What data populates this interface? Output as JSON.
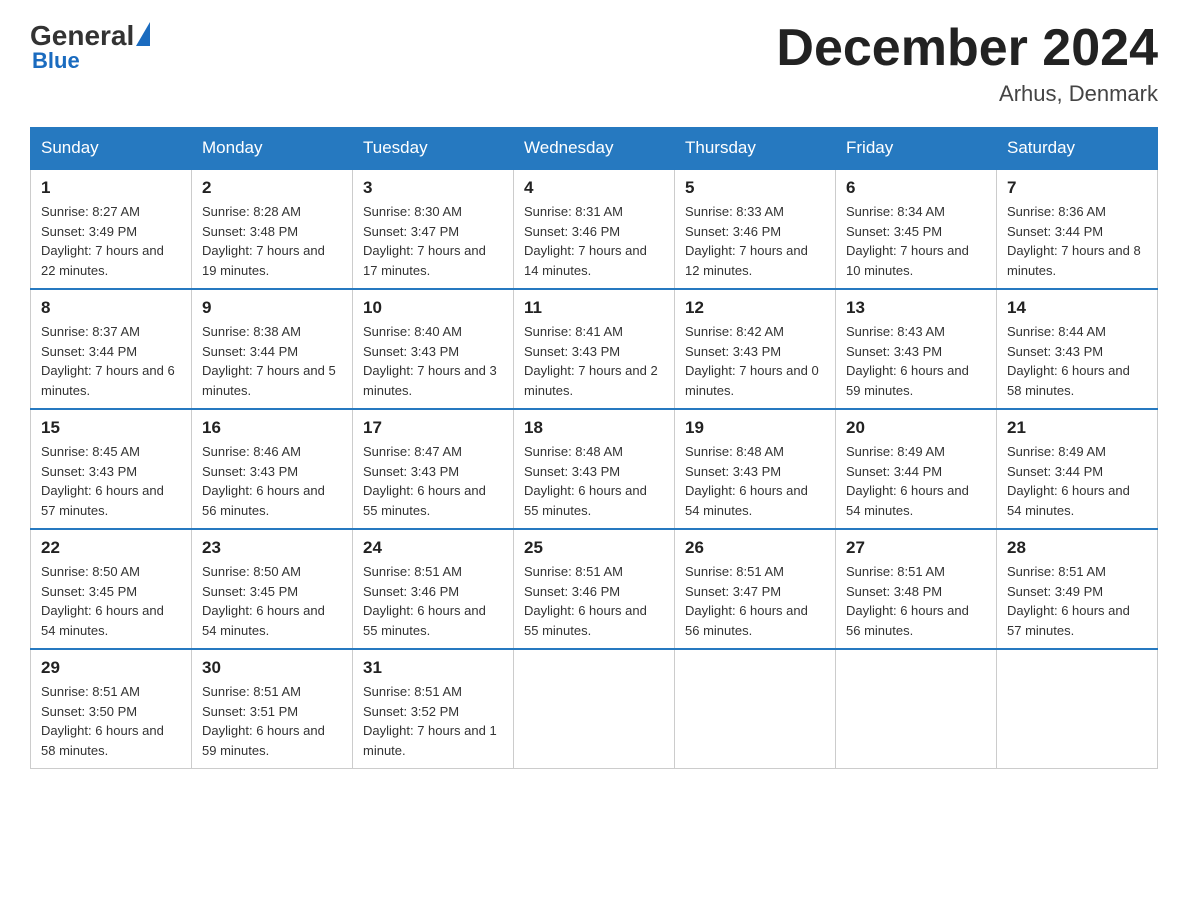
{
  "header": {
    "logo_general": "General",
    "logo_blue": "Blue",
    "month_title": "December 2024",
    "location": "Arhus, Denmark"
  },
  "days_of_week": [
    "Sunday",
    "Monday",
    "Tuesday",
    "Wednesday",
    "Thursday",
    "Friday",
    "Saturday"
  ],
  "weeks": [
    [
      {
        "day": "1",
        "sunrise": "Sunrise: 8:27 AM",
        "sunset": "Sunset: 3:49 PM",
        "daylight": "Daylight: 7 hours and 22 minutes."
      },
      {
        "day": "2",
        "sunrise": "Sunrise: 8:28 AM",
        "sunset": "Sunset: 3:48 PM",
        "daylight": "Daylight: 7 hours and 19 minutes."
      },
      {
        "day": "3",
        "sunrise": "Sunrise: 8:30 AM",
        "sunset": "Sunset: 3:47 PM",
        "daylight": "Daylight: 7 hours and 17 minutes."
      },
      {
        "day": "4",
        "sunrise": "Sunrise: 8:31 AM",
        "sunset": "Sunset: 3:46 PM",
        "daylight": "Daylight: 7 hours and 14 minutes."
      },
      {
        "day": "5",
        "sunrise": "Sunrise: 8:33 AM",
        "sunset": "Sunset: 3:46 PM",
        "daylight": "Daylight: 7 hours and 12 minutes."
      },
      {
        "day": "6",
        "sunrise": "Sunrise: 8:34 AM",
        "sunset": "Sunset: 3:45 PM",
        "daylight": "Daylight: 7 hours and 10 minutes."
      },
      {
        "day": "7",
        "sunrise": "Sunrise: 8:36 AM",
        "sunset": "Sunset: 3:44 PM",
        "daylight": "Daylight: 7 hours and 8 minutes."
      }
    ],
    [
      {
        "day": "8",
        "sunrise": "Sunrise: 8:37 AM",
        "sunset": "Sunset: 3:44 PM",
        "daylight": "Daylight: 7 hours and 6 minutes."
      },
      {
        "day": "9",
        "sunrise": "Sunrise: 8:38 AM",
        "sunset": "Sunset: 3:44 PM",
        "daylight": "Daylight: 7 hours and 5 minutes."
      },
      {
        "day": "10",
        "sunrise": "Sunrise: 8:40 AM",
        "sunset": "Sunset: 3:43 PM",
        "daylight": "Daylight: 7 hours and 3 minutes."
      },
      {
        "day": "11",
        "sunrise": "Sunrise: 8:41 AM",
        "sunset": "Sunset: 3:43 PM",
        "daylight": "Daylight: 7 hours and 2 minutes."
      },
      {
        "day": "12",
        "sunrise": "Sunrise: 8:42 AM",
        "sunset": "Sunset: 3:43 PM",
        "daylight": "Daylight: 7 hours and 0 minutes."
      },
      {
        "day": "13",
        "sunrise": "Sunrise: 8:43 AM",
        "sunset": "Sunset: 3:43 PM",
        "daylight": "Daylight: 6 hours and 59 minutes."
      },
      {
        "day": "14",
        "sunrise": "Sunrise: 8:44 AM",
        "sunset": "Sunset: 3:43 PM",
        "daylight": "Daylight: 6 hours and 58 minutes."
      }
    ],
    [
      {
        "day": "15",
        "sunrise": "Sunrise: 8:45 AM",
        "sunset": "Sunset: 3:43 PM",
        "daylight": "Daylight: 6 hours and 57 minutes."
      },
      {
        "day": "16",
        "sunrise": "Sunrise: 8:46 AM",
        "sunset": "Sunset: 3:43 PM",
        "daylight": "Daylight: 6 hours and 56 minutes."
      },
      {
        "day": "17",
        "sunrise": "Sunrise: 8:47 AM",
        "sunset": "Sunset: 3:43 PM",
        "daylight": "Daylight: 6 hours and 55 minutes."
      },
      {
        "day": "18",
        "sunrise": "Sunrise: 8:48 AM",
        "sunset": "Sunset: 3:43 PM",
        "daylight": "Daylight: 6 hours and 55 minutes."
      },
      {
        "day": "19",
        "sunrise": "Sunrise: 8:48 AM",
        "sunset": "Sunset: 3:43 PM",
        "daylight": "Daylight: 6 hours and 54 minutes."
      },
      {
        "day": "20",
        "sunrise": "Sunrise: 8:49 AM",
        "sunset": "Sunset: 3:44 PM",
        "daylight": "Daylight: 6 hours and 54 minutes."
      },
      {
        "day": "21",
        "sunrise": "Sunrise: 8:49 AM",
        "sunset": "Sunset: 3:44 PM",
        "daylight": "Daylight: 6 hours and 54 minutes."
      }
    ],
    [
      {
        "day": "22",
        "sunrise": "Sunrise: 8:50 AM",
        "sunset": "Sunset: 3:45 PM",
        "daylight": "Daylight: 6 hours and 54 minutes."
      },
      {
        "day": "23",
        "sunrise": "Sunrise: 8:50 AM",
        "sunset": "Sunset: 3:45 PM",
        "daylight": "Daylight: 6 hours and 54 minutes."
      },
      {
        "day": "24",
        "sunrise": "Sunrise: 8:51 AM",
        "sunset": "Sunset: 3:46 PM",
        "daylight": "Daylight: 6 hours and 55 minutes."
      },
      {
        "day": "25",
        "sunrise": "Sunrise: 8:51 AM",
        "sunset": "Sunset: 3:46 PM",
        "daylight": "Daylight: 6 hours and 55 minutes."
      },
      {
        "day": "26",
        "sunrise": "Sunrise: 8:51 AM",
        "sunset": "Sunset: 3:47 PM",
        "daylight": "Daylight: 6 hours and 56 minutes."
      },
      {
        "day": "27",
        "sunrise": "Sunrise: 8:51 AM",
        "sunset": "Sunset: 3:48 PM",
        "daylight": "Daylight: 6 hours and 56 minutes."
      },
      {
        "day": "28",
        "sunrise": "Sunrise: 8:51 AM",
        "sunset": "Sunset: 3:49 PM",
        "daylight": "Daylight: 6 hours and 57 minutes."
      }
    ],
    [
      {
        "day": "29",
        "sunrise": "Sunrise: 8:51 AM",
        "sunset": "Sunset: 3:50 PM",
        "daylight": "Daylight: 6 hours and 58 minutes."
      },
      {
        "day": "30",
        "sunrise": "Sunrise: 8:51 AM",
        "sunset": "Sunset: 3:51 PM",
        "daylight": "Daylight: 6 hours and 59 minutes."
      },
      {
        "day": "31",
        "sunrise": "Sunrise: 8:51 AM",
        "sunset": "Sunset: 3:52 PM",
        "daylight": "Daylight: 7 hours and 1 minute."
      },
      null,
      null,
      null,
      null
    ]
  ]
}
